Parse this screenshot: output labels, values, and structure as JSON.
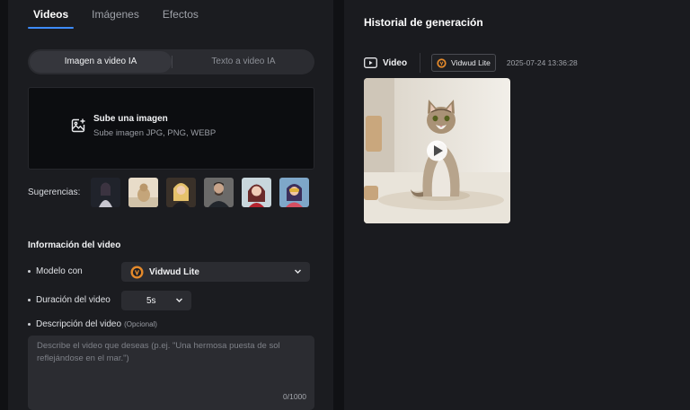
{
  "tabs": [
    "Videos",
    "Imágenes",
    "Efectos"
  ],
  "mode_switch": {
    "option_1": "Imagen a video IA",
    "option_2": "Texto a video IA"
  },
  "upload": {
    "title": "Sube una imagen",
    "subtitle": "Sube imagen JPG, PNG, WEBP",
    "icon": "image-add-icon"
  },
  "suggestions": {
    "label": "Sugerencias:"
  },
  "info": {
    "title": "Información del video",
    "model_label": "Modelo con",
    "model_value": "Vidwud Lite",
    "duration_label": "Duración del video",
    "duration_value": "5s",
    "description_label": "Descripción del video",
    "description_optional": "(Opcional)",
    "description_placeholder": "Describe el video que deseas (p.ej. \"Una hermosa puesta de sol reflejándose en el mar.\")",
    "counter": "0/1000"
  },
  "history": {
    "title": "Historial de generación",
    "type_label": "Video",
    "model_badge": "Vidwud Lite",
    "timestamp": "2025-07-24 13:36:28"
  },
  "colors": {
    "accent": "#3d8bff",
    "panel": "#1b1c20",
    "model_badge": "#e58a2b"
  }
}
